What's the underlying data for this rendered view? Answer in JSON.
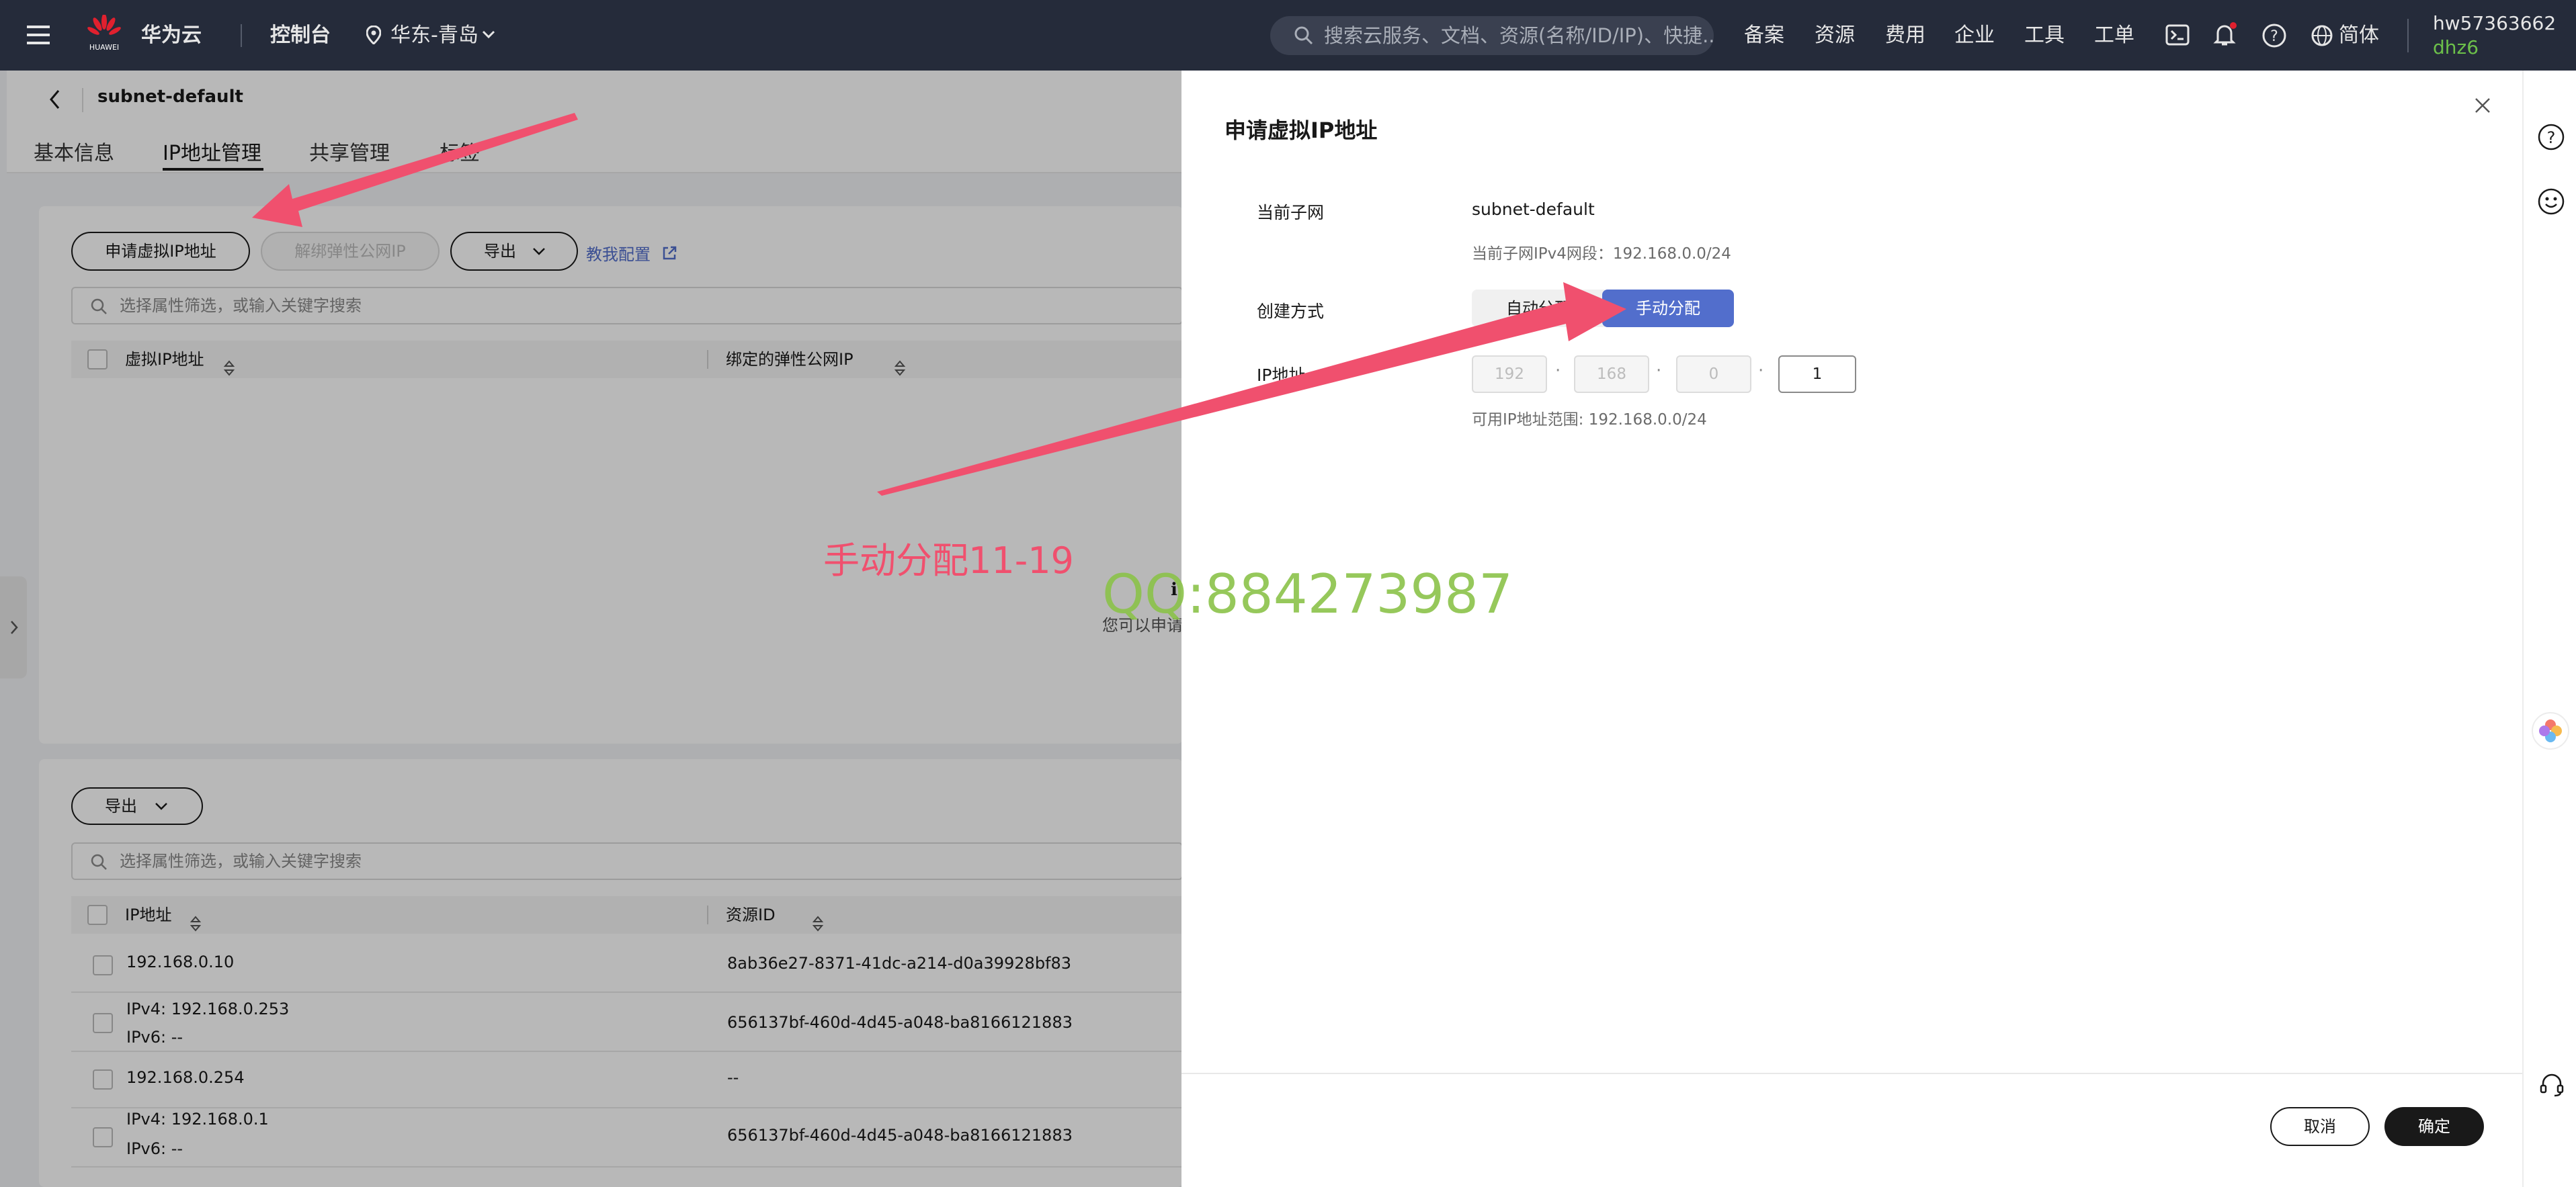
{
  "topbar": {
    "brand": "华为云",
    "logo_text": "HUAWEI",
    "console": "控制台",
    "region": "华东-青岛",
    "search_placeholder": "搜索云服务、文档、资源(名称/ID/IP)、快捷...",
    "nav": [
      "备案",
      "资源",
      "费用",
      "企业",
      "工具",
      "工单"
    ],
    "lang": "简体",
    "user": "hw57363662",
    "user_sub": "dhz6"
  },
  "page": {
    "title": "subnet-default",
    "tabs": [
      "基本信息",
      "IP地址管理",
      "共享管理",
      "标签"
    ],
    "top_section": {
      "apply_btn": "申请虚拟IP地址",
      "unbind_btn": "解绑弹性公网IP",
      "export_btn": "导出",
      "help_link": "教我配置",
      "filter_placeholder": "选择属性筛选，或输入关键字搜索",
      "col1": "虚拟IP地址",
      "col2": "绑定的弹性公网IP",
      "empty_text": "您可以申请"
    },
    "bottom_section": {
      "export_btn": "导出",
      "filter_placeholder": "选择属性筛选，或输入关键字搜索",
      "col1": "IP地址",
      "col2": "资源ID",
      "rows": [
        {
          "ip": "192.168.0.10",
          "ip2": "",
          "rid": "8ab36e27-8371-41dc-a214-d0a39928bf83"
        },
        {
          "ip": "IPv4: 192.168.0.253",
          "ip2": "IPv6: --",
          "rid": "656137bf-460d-4d45-a048-ba8166121883"
        },
        {
          "ip": "192.168.0.254",
          "ip2": "",
          "rid": "--"
        },
        {
          "ip": "IPv4: 192.168.0.1",
          "ip2": "IPv6: --",
          "rid": "656137bf-460d-4d45-a048-ba8166121883"
        }
      ]
    }
  },
  "drawer": {
    "title": "申请虚拟IP地址",
    "subnet_label": "当前子网",
    "subnet_value": "subnet-default",
    "subnet_cidr": "当前子网IPv4网段：192.168.0.0/24",
    "mode_label": "创建方式",
    "mode_auto": "自动分配",
    "mode_manual": "手动分配",
    "ip_label": "IP地址",
    "ip_parts": [
      "192",
      "168",
      "0",
      "1"
    ],
    "ip_range": "可用IP地址范围: 192.168.0.0/24",
    "cancel": "取消",
    "confirm": "确定"
  },
  "annotations": {
    "text": "手动分配11-19",
    "watermark": "QQ:884273987"
  },
  "colors": {
    "topbar": "#252b3a",
    "primary": "#526ecc",
    "annotation": "#f0506e",
    "watermark": "#8bc34a"
  }
}
